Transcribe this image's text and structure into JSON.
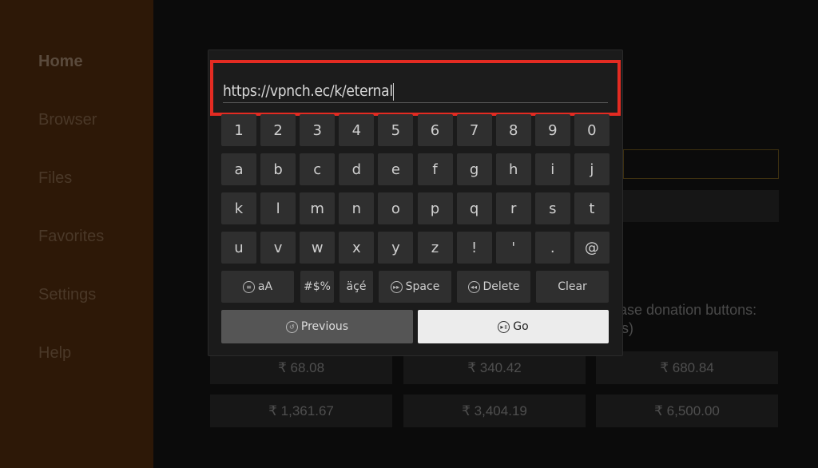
{
  "sidebar": {
    "items": [
      {
        "label": "Home",
        "active": true
      },
      {
        "label": "Browser"
      },
      {
        "label": "Files"
      },
      {
        "label": "Favorites"
      },
      {
        "label": "Settings"
      },
      {
        "label": "Help"
      }
    ]
  },
  "background": {
    "donation_text": "ase donation buttons:",
    "donation_text2": "s)",
    "donations": [
      "₹ 68.08",
      "₹ 340.42",
      "₹ 680.84",
      "₹ 1,361.67",
      "₹ 3,404.19",
      "₹ 6,500.00"
    ]
  },
  "dialog": {
    "url_value": "https://vpnch.ec/k/eternal",
    "highlight_color": "#e32b22",
    "rows": [
      [
        "1",
        "2",
        "3",
        "4",
        "5",
        "6",
        "7",
        "8",
        "9",
        "0"
      ],
      [
        "a",
        "b",
        "c",
        "d",
        "e",
        "f",
        "g",
        "h",
        "i",
        "j"
      ],
      [
        "k",
        "l",
        "m",
        "n",
        "o",
        "p",
        "q",
        "r",
        "s",
        "t"
      ],
      [
        "u",
        "v",
        "w",
        "x",
        "y",
        "z",
        "!",
        "'",
        ".",
        "@"
      ]
    ],
    "case_label": "aA",
    "symbols_label": "#$%",
    "accents_label": "äçé",
    "space_label": "Space",
    "delete_label": "Delete",
    "clear_label": "Clear",
    "previous_label": "Previous",
    "go_label": "Go"
  }
}
